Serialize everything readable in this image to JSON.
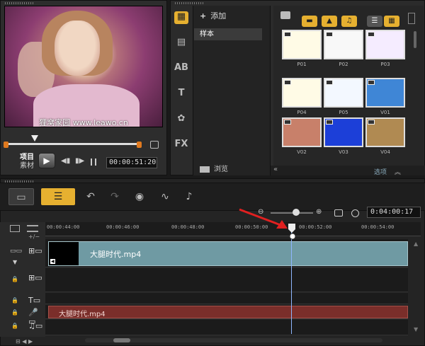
{
  "preview": {
    "watermark": "狸窝家园 www.leawo.cn",
    "mode_project": "项目",
    "mode_clip": "素材",
    "timecode": "00:00:51:20",
    "play_icon": "play-icon",
    "colors": {
      "trim": "#e07a1f"
    }
  },
  "library": {
    "add_label": "添加",
    "folder": "样本",
    "browse_label": "浏览",
    "options_label": "选项",
    "thumbnails": [
      {
        "label": "P01",
        "color": "#fffbe6"
      },
      {
        "label": "P02",
        "color": "#f8f8f8"
      },
      {
        "label": "P03",
        "color": "#f5ecff"
      },
      {
        "label": "P04",
        "color": "#fffbe6"
      },
      {
        "label": "P05",
        "color": "#f3f8ff"
      },
      {
        "label": "V01",
        "color": "#3f86d6"
      },
      {
        "label": "V02",
        "color": "#c8806a"
      },
      {
        "label": "V03",
        "color": "#1c3fd8"
      },
      {
        "label": "V04",
        "color": "#b08a52"
      }
    ],
    "accent": "#e6b030"
  },
  "timeline": {
    "timecode": "0:04:00:17",
    "ruler": [
      "00:00:44:00",
      "00:00:46:00",
      "00:00:48:00",
      "00:00:50:00",
      "00:00:52:00",
      "00:00:54:00"
    ],
    "video_clip": "大腿时代.mp4",
    "audio_clip": "大腿时代.mp4",
    "colors": {
      "video_clip": "#6f9aa3",
      "audio_clip": "#7a2e2a",
      "playhead": "#8fb7ff",
      "arrow": "#e02020"
    }
  }
}
